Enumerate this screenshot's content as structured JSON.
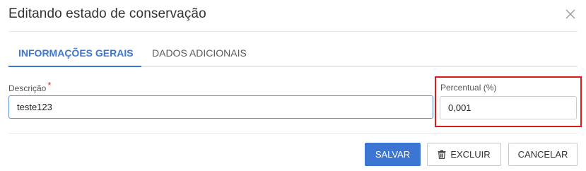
{
  "dialog": {
    "title": "Editando estado de conservação",
    "close_icon": "close-icon"
  },
  "tabs": [
    {
      "label": "INFORMAÇÕES GERAIS",
      "active": true
    },
    {
      "label": "DADOS ADICIONAIS",
      "active": false
    }
  ],
  "form": {
    "description": {
      "label": "Descrição",
      "required_mark": "*",
      "value": "teste123"
    },
    "percentage": {
      "label": "Percentual (%)",
      "value": "0,001"
    }
  },
  "buttons": {
    "save": "SALVAR",
    "delete": "EXCLUIR",
    "delete_icon": "trash-icon",
    "cancel": "CANCELAR"
  },
  "colors": {
    "accent": "#3a76d2",
    "required": "#e02424",
    "highlight_box": "#d81c1c"
  }
}
